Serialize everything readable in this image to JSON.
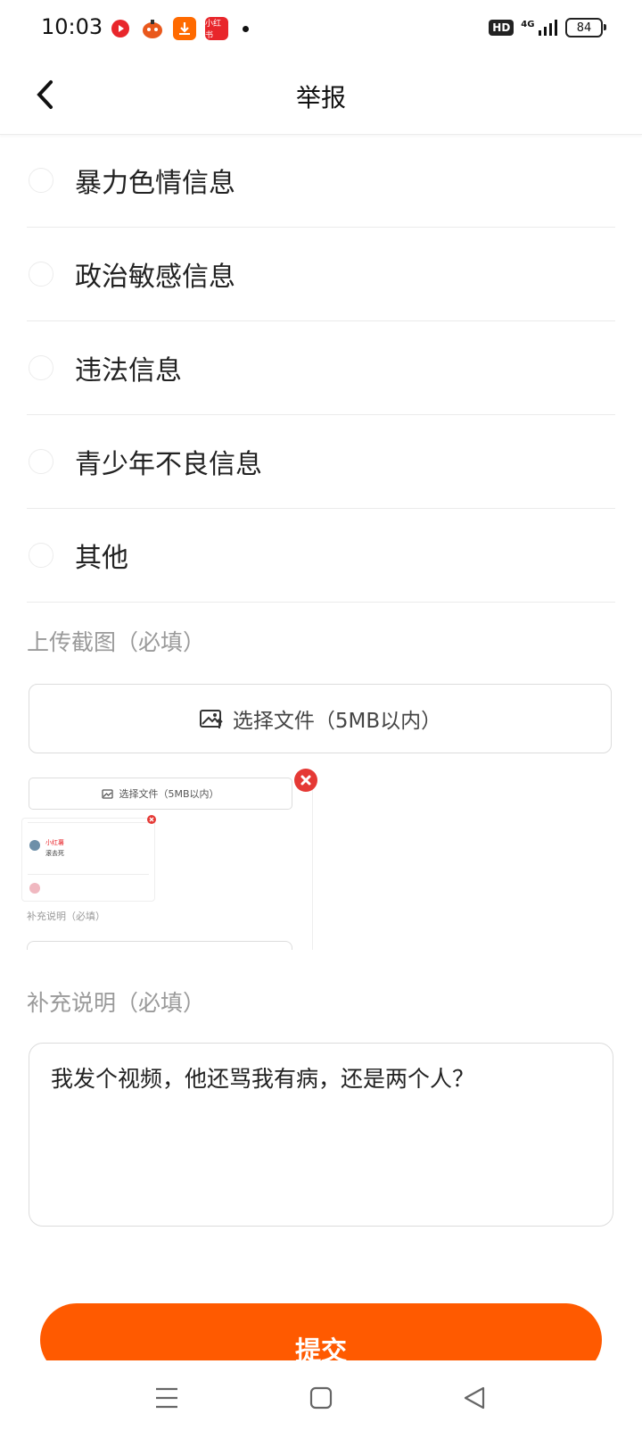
{
  "status_bar": {
    "time": "10:03",
    "app_icons": [
      {
        "name": "video-app-icon",
        "color": "#e8262b"
      },
      {
        "name": "game-app-icon",
        "color": "#e9581c"
      },
      {
        "name": "download-app-icon",
        "color": "#ff6a00"
      },
      {
        "name": "mini-app-icon",
        "color": "#e8262b",
        "text": "小红书"
      }
    ],
    "hd": "HD",
    "network": "4G",
    "battery": "84"
  },
  "header": {
    "title": "举报"
  },
  "options": [
    {
      "label": "暴力色情信息"
    },
    {
      "label": "政治敏感信息"
    },
    {
      "label": "违法信息"
    },
    {
      "label": "青少年不良信息"
    },
    {
      "label": "其他"
    }
  ],
  "upload": {
    "section_label": "上传截图（必填）",
    "button_label": "选择文件（5MB以内）",
    "thumbnail": {
      "upload_label": "选择文件（5MB以内）",
      "user_name": "小红薯",
      "comment": "滚去死",
      "label": "补充说明（必填）"
    }
  },
  "description": {
    "section_label": "补充说明（必填）",
    "value": "我发个视频，他还骂我有病，还是两个人？"
  },
  "submit": {
    "label": "提交"
  },
  "colors": {
    "accent": "#ff5a00",
    "delete": "#e53935"
  }
}
